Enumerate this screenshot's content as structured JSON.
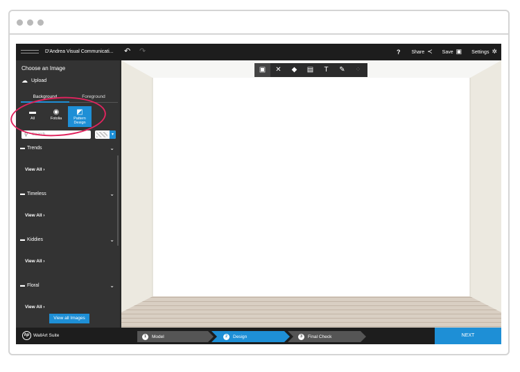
{
  "app": {
    "brand_name": "D'Andrea Visual Communicati..."
  },
  "topbar": {
    "help_label": "?",
    "share_label": "Share",
    "save_label": "Save",
    "settings_label": "Settings"
  },
  "sidebar": {
    "title": "Choose an Image",
    "upload_label": "Upload",
    "tabs": [
      {
        "label": "Background"
      },
      {
        "label": "Foreground"
      }
    ],
    "sources": [
      {
        "label": "All"
      },
      {
        "label": "Fotolia"
      },
      {
        "label": "Pattern Design"
      }
    ],
    "search_placeholder": "Search",
    "categories": [
      {
        "name": "Trends",
        "view_all": "View All"
      },
      {
        "name": "Timeless",
        "view_all": "View All"
      },
      {
        "name": "Kiddies",
        "view_all": "View All"
      },
      {
        "name": "Floral",
        "view_all": "View All"
      }
    ],
    "view_all_images": "View all Images"
  },
  "footer": {
    "suite_name": "WallArt Suite",
    "steps": [
      {
        "num": "1",
        "label": "Model"
      },
      {
        "num": "2",
        "label": "Design"
      },
      {
        "num": "3",
        "label": "Final Check"
      }
    ],
    "next_label": "NEXT"
  },
  "colors": {
    "accent": "#1e8fd6",
    "highlight": "#e0245e",
    "topbar": "#1d1d1d",
    "sidebar": "#333333"
  }
}
